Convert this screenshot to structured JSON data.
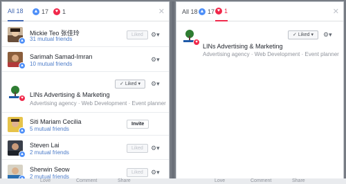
{
  "left": {
    "tabs": [
      {
        "label": "All 18"
      },
      {
        "count": "17"
      },
      {
        "count": "1"
      }
    ],
    "rows": [
      {
        "name": "Mickie Teo 张佳玲",
        "sub": "31 mutual friends",
        "button": "Liked"
      },
      {
        "name": "Sarimah Samad-Imran",
        "sub": "10 mutual friends",
        "button": ""
      },
      {
        "name": "LINs Advertising & Marketing",
        "sub": "Advertising agency · Web Development · Event planner",
        "button": "Liked"
      },
      {
        "name": "Siti Mariam Cecilia",
        "sub": "5 mutual friends",
        "button": "Invite"
      },
      {
        "name": "Steven Lai",
        "sub": "2 mutual friends",
        "button": "Liked"
      },
      {
        "name": "Sherwin Seow",
        "sub": "2 mutual friends",
        "button": "Liked"
      }
    ]
  },
  "right": {
    "tabs": [
      {
        "label": "All 18"
      },
      {
        "count": "17"
      },
      {
        "count": "1"
      }
    ],
    "rows": [
      {
        "name": "LINs Advertising & Marketing",
        "sub": "Advertising agency · Web Development · Event planner",
        "button": "Liked"
      }
    ]
  },
  "bottom_strip": [
    "Love",
    "Comment",
    "Share",
    "Love",
    "Comment",
    "Share"
  ],
  "icons": {
    "close": "close-icon",
    "gear": "gear-icon",
    "like": "thumbs-up-icon",
    "heart": "heart-icon"
  },
  "colors": {
    "accent": "#4267b2",
    "like": "#4e8ff8",
    "heart": "#f0284a"
  }
}
